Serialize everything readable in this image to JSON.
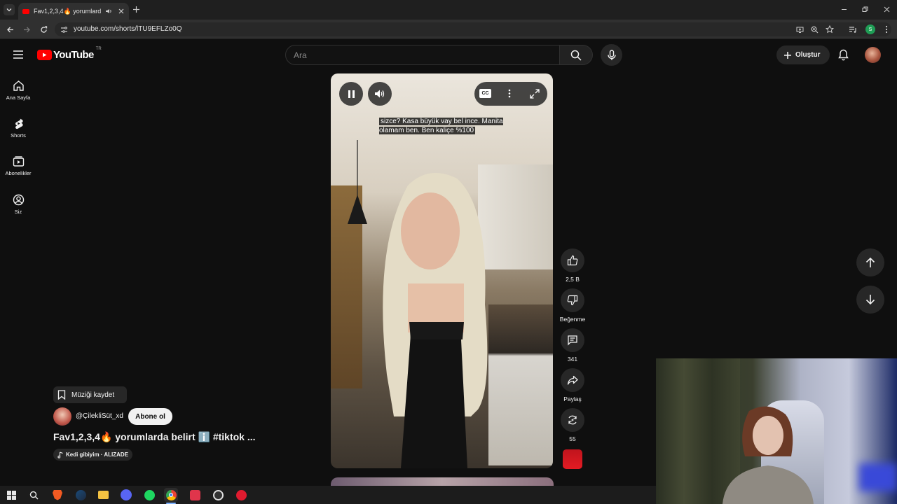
{
  "browser": {
    "tab_title": "Fav1,2,3,4🔥 yorumlarda belirt",
    "url": "youtube.com/shorts/lTU9EFLZo0Q"
  },
  "header": {
    "logo_text": "YouTube",
    "region": "TR",
    "search_placeholder": "Ara",
    "create_label": "Oluştur"
  },
  "sidebar": {
    "items": [
      {
        "label": "Ana Sayfa",
        "icon": "home-icon"
      },
      {
        "label": "Shorts",
        "icon": "shorts-icon"
      },
      {
        "label": "Abonelikler",
        "icon": "subscriptions-icon"
      },
      {
        "label": "Siz",
        "icon": "user-icon"
      }
    ]
  },
  "video": {
    "caption": "sizce? Kasa büyük vay bel ince. Manita olamam ben. Ben kaliçe %100"
  },
  "actions": {
    "likes": "2,5 B",
    "dislike_label": "Beğenme",
    "comments": "341",
    "share_label": "Paylaş",
    "remix": "55"
  },
  "info": {
    "save_music": "Müziği kaydet",
    "channel": "@ÇilekliSüt_xd",
    "subscribe": "Abone ol",
    "title": "Fav1,2,3,4🔥 yorumlarda belirt ℹ️ #tiktok ...",
    "song": "Kedi gibiyim · ALIZADE"
  },
  "colors": {
    "brand_red": "#ff0000",
    "background": "#0f0f0f",
    "surface": "#272727"
  }
}
